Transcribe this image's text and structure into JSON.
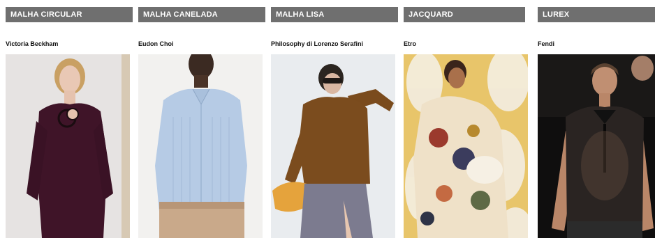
{
  "categories": [
    {
      "label": "MALHA CIRCULAR",
      "designer": "Victoria Beckham",
      "icon": "model-photo-burgundy-dress"
    },
    {
      "label": "MALHA CANELADA",
      "designer": "Eudon Choi",
      "icon": "model-photo-blue-cardigan"
    },
    {
      "label": "MALHA LISA",
      "designer": "Philosophy di Lorenzo Serafini",
      "icon": "model-photo-brown-sweater"
    },
    {
      "label": "JACQUARD",
      "designer": "Etro",
      "icon": "model-photo-jacquard-coat"
    },
    {
      "label": "LUREX",
      "designer": "Fendi",
      "icon": "model-photo-mesh-shirt"
    }
  ],
  "colors": {
    "header_bg": "#6f6f6f",
    "header_text": "#ffffff"
  }
}
